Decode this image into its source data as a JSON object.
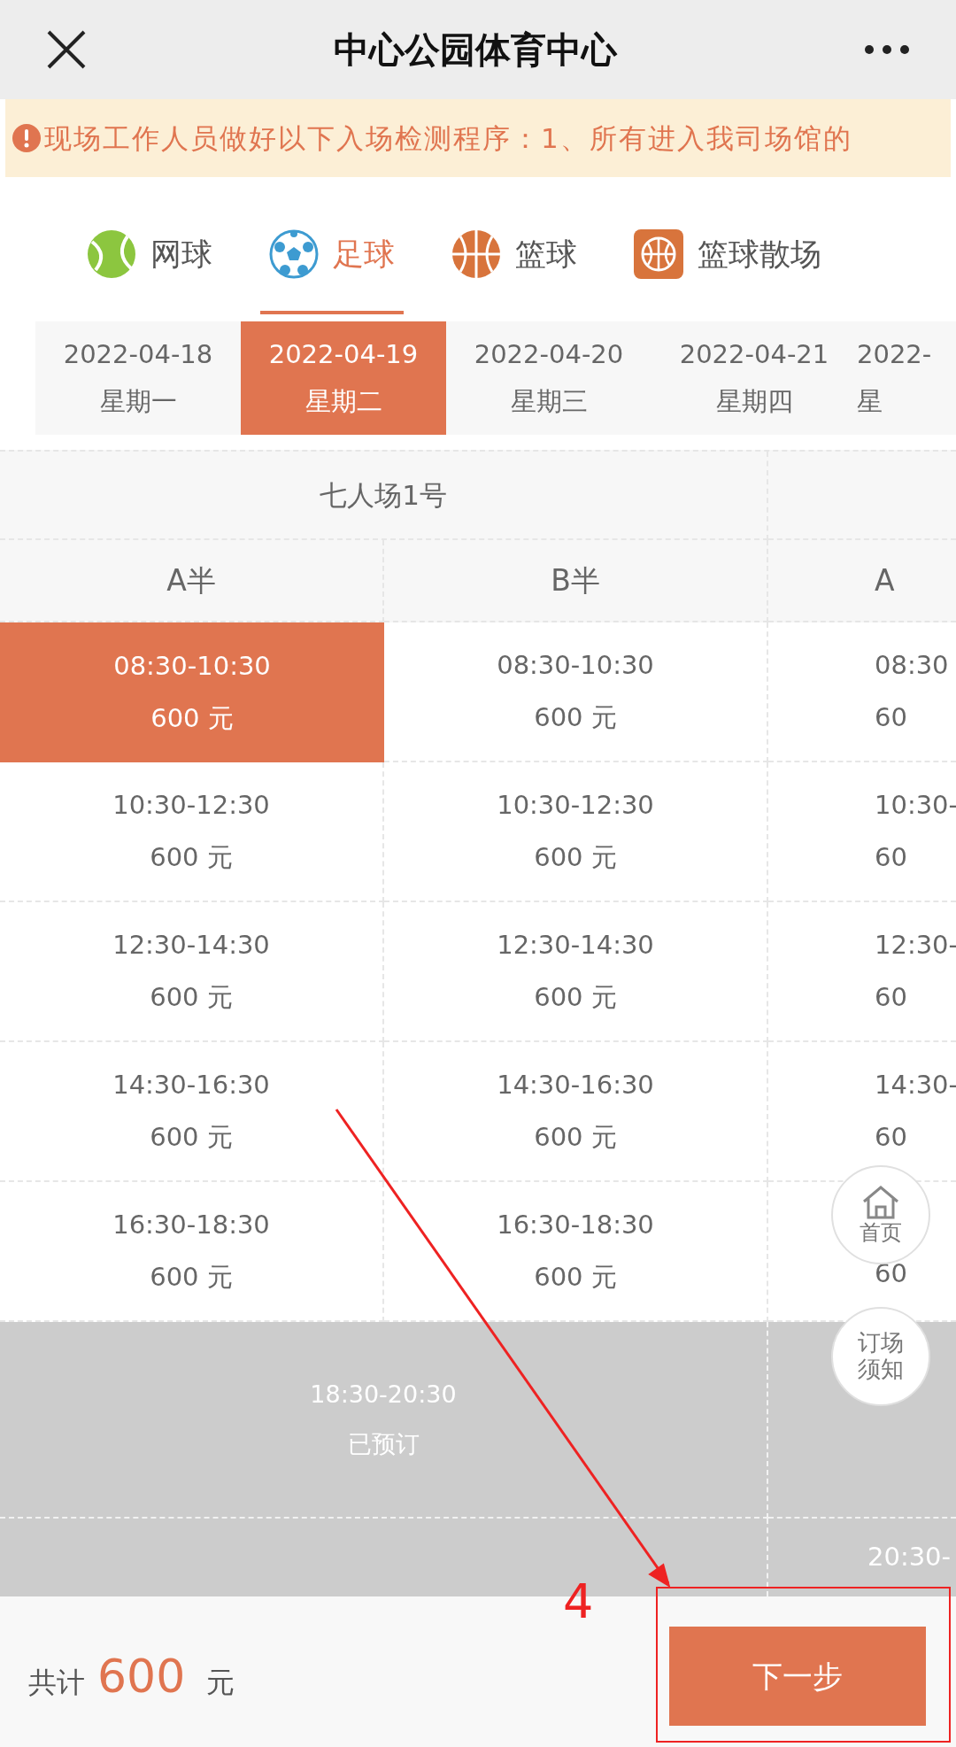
{
  "header": {
    "title": "中心公园体育中心"
  },
  "notice": "现场工作人员做好以下入场检测程序：1、所有进入我司场馆的",
  "sports": [
    {
      "label": "网球",
      "kind": "tennis",
      "selected": false
    },
    {
      "label": "足球",
      "kind": "soccer",
      "selected": true
    },
    {
      "label": "篮球",
      "kind": "basketball",
      "selected": false
    },
    {
      "label": "篮球散场",
      "kind": "basketball_square",
      "selected": false
    }
  ],
  "dates": [
    {
      "date": "2022-04-18",
      "weekday": "星期一",
      "selected": false
    },
    {
      "date": "2022-04-19",
      "weekday": "星期二",
      "selected": true
    },
    {
      "date": "2022-04-20",
      "weekday": "星期三",
      "selected": false
    },
    {
      "date": "2022-04-21",
      "weekday": "星期四",
      "selected": false
    },
    {
      "date": "2022-",
      "weekday": "星",
      "selected": false
    }
  ],
  "court": {
    "name": "七人场1号",
    "halves": [
      "A半",
      "B半"
    ],
    "next_half": "A"
  },
  "rows": [
    {
      "kind": "open",
      "cells": [
        {
          "time": "08:30-10:30",
          "price": "600 元",
          "selected": true
        },
        {
          "time": "08:30-10:30",
          "price": "600 元",
          "selected": false
        }
      ],
      "next": {
        "time": "08:30",
        "price": "60"
      }
    },
    {
      "kind": "open",
      "cells": [
        {
          "time": "10:30-12:30",
          "price": "600 元",
          "selected": false
        },
        {
          "time": "10:30-12:30",
          "price": "600 元",
          "selected": false
        }
      ],
      "next": {
        "time": "10:30-",
        "price": "60"
      }
    },
    {
      "kind": "open",
      "cells": [
        {
          "time": "12:30-14:30",
          "price": "600 元",
          "selected": false
        },
        {
          "time": "12:30-14:30",
          "price": "600 元",
          "selected": false
        }
      ],
      "next": {
        "time": "12:30-",
        "price": "60"
      }
    },
    {
      "kind": "open",
      "cells": [
        {
          "time": "14:30-16:30",
          "price": "600 元",
          "selected": false
        },
        {
          "time": "14:30-16:30",
          "price": "600 元",
          "selected": false
        }
      ],
      "next": {
        "time": "14:30-",
        "price": "60"
      }
    },
    {
      "kind": "open",
      "cells": [
        {
          "time": "16:30-18:30",
          "price": "600 元",
          "selected": false
        },
        {
          "time": "16:30-18:30",
          "price": "600 元",
          "selected": false
        }
      ],
      "next": {
        "price": "60"
      }
    },
    {
      "kind": "booked",
      "time": "18:30-20:30",
      "status": "已预订"
    },
    {
      "kind": "partial",
      "next": {
        "time": "20:30-"
      }
    }
  ],
  "floating": [
    {
      "kind": "home",
      "label": "首页"
    },
    {
      "kind": "rules",
      "label": "订场须知"
    }
  ],
  "footer": {
    "total_label": "共计",
    "amount": "600",
    "unit": "元",
    "button": "下一步"
  },
  "annotation": {
    "step": "4"
  }
}
